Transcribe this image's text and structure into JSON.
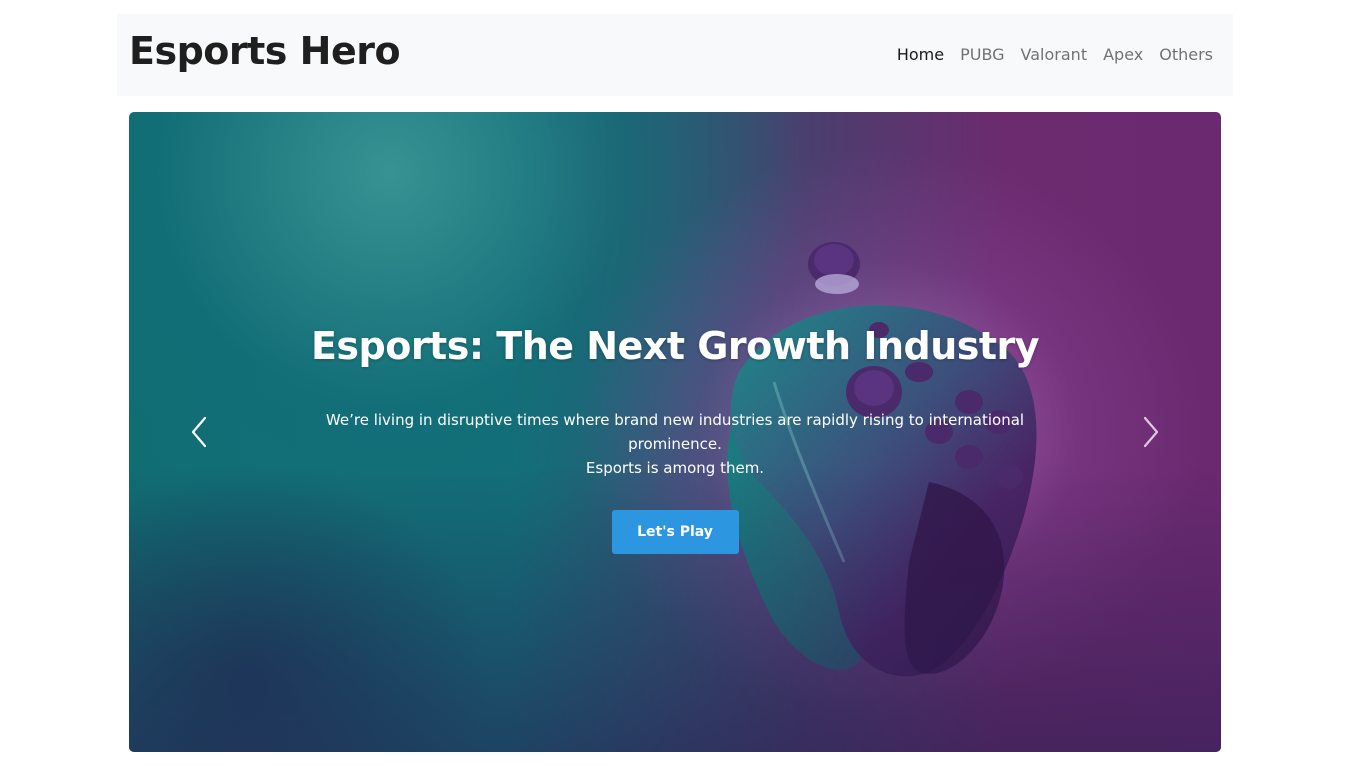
{
  "navbar": {
    "brand": "Esports Hero",
    "links": [
      {
        "label": "Home",
        "active": true
      },
      {
        "label": "PUBG",
        "active": false
      },
      {
        "label": "Valorant",
        "active": false
      },
      {
        "label": "Apex",
        "active": false
      },
      {
        "label": "Others",
        "active": false
      }
    ]
  },
  "hero": {
    "title": "Esports: The Next Growth Industry",
    "text_line1": "We’re living in disruptive times where brand new industries are rapidly rising to international prominence.",
    "text_line2": "Esports is among them.",
    "button_label": "Let's Play",
    "button_color": "#2d96e0",
    "prev_icon": "chevron-left-icon",
    "next_icon": "chevron-right-icon"
  }
}
